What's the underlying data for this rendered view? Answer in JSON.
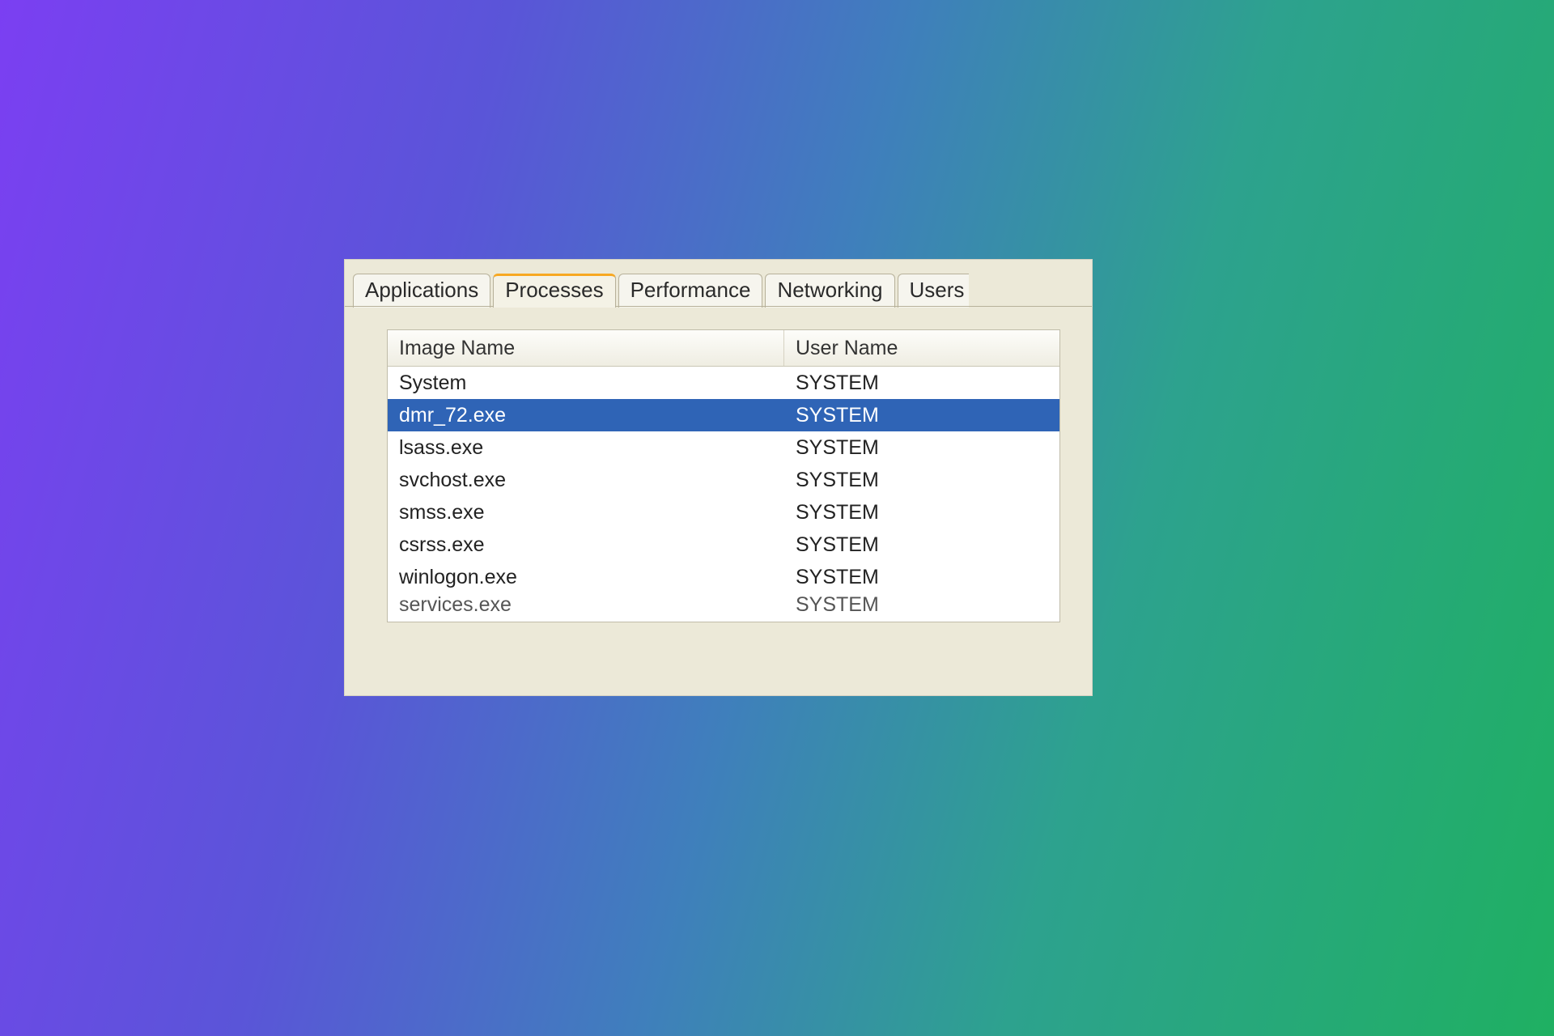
{
  "tabs": {
    "applications": "Applications",
    "processes": "Processes",
    "performance": "Performance",
    "networking": "Networking",
    "users": "Users"
  },
  "columns": {
    "image_name": "Image Name",
    "user_name": "User Name"
  },
  "rows": [
    {
      "image": "System",
      "user": "SYSTEM",
      "selected": false
    },
    {
      "image": "dmr_72.exe",
      "user": "SYSTEM",
      "selected": true
    },
    {
      "image": "lsass.exe",
      "user": "SYSTEM",
      "selected": false
    },
    {
      "image": "svchost.exe",
      "user": "SYSTEM",
      "selected": false
    },
    {
      "image": "smss.exe",
      "user": "SYSTEM",
      "selected": false
    },
    {
      "image": "csrss.exe",
      "user": "SYSTEM",
      "selected": false
    },
    {
      "image": "winlogon.exe",
      "user": "SYSTEM",
      "selected": false
    }
  ],
  "partial_row": {
    "image": "services.exe",
    "user": "SYSTEM"
  }
}
